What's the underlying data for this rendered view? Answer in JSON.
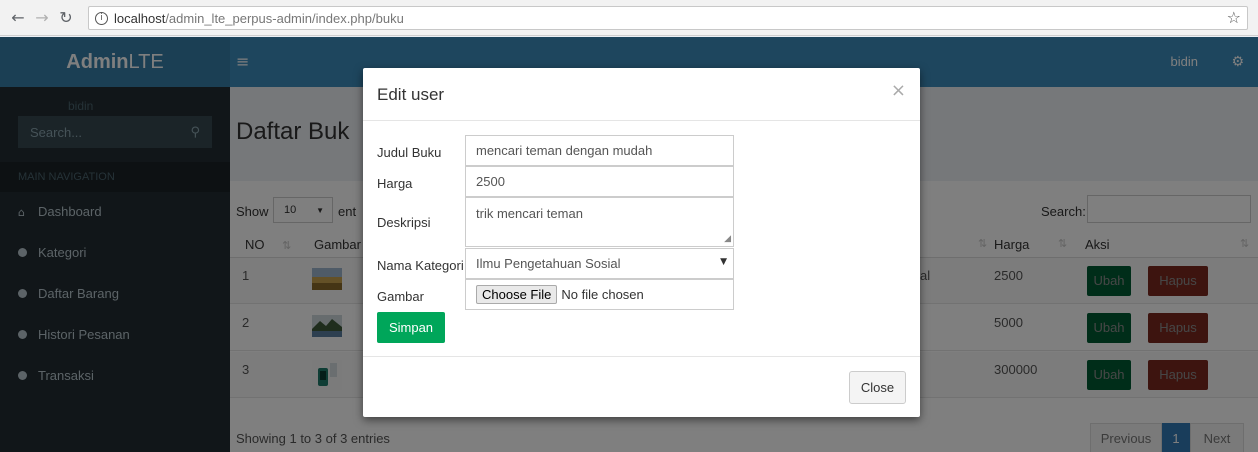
{
  "browser": {
    "back_icon": "arrow-left-icon",
    "forward_icon": "arrow-right-icon",
    "reload_icon": "reload-icon",
    "url_prefix": "localhost",
    "url_path": "/admin_lte_perpus-admin/index.php/buku"
  },
  "header": {
    "logo_bold": "Admin",
    "logo_rest": "LTE",
    "user": "bidin"
  },
  "sidebar": {
    "user": "bidin",
    "search_placeholder": "Search...",
    "nav_header": "MAIN NAVIGATION",
    "items": [
      {
        "label": "Dashboard",
        "icon": "home-icon"
      },
      {
        "label": "Kategori",
        "icon": "circle-icon"
      },
      {
        "label": "Daftar Barang",
        "icon": "circle-icon"
      },
      {
        "label": "Histori Pesanan",
        "icon": "circle-icon"
      },
      {
        "label": "Transaksi",
        "icon": "circle-icon"
      }
    ]
  },
  "content": {
    "title": "Daftar Buk",
    "show_label": "Show",
    "entries_length": "10",
    "entries_label": "ent",
    "search_label": "Search:",
    "columns": {
      "no": "NO",
      "gambar": "Gambar",
      "harga": "Harga",
      "aksi": "Aksi"
    },
    "rows": [
      {
        "no": "1",
        "tail": "al",
        "harga": "2500"
      },
      {
        "no": "2",
        "tail": "",
        "harga": "5000"
      },
      {
        "no": "3",
        "tail": "",
        "harga": "300000"
      }
    ],
    "btn_ubah": "Ubah",
    "btn_hapus": "Hapus",
    "footer_info": "Showing 1 to 3 of 3 entries",
    "pager": {
      "previous": "Previous",
      "current": "1",
      "next": "Next"
    }
  },
  "modal": {
    "title": "Edit user",
    "close_x": "×",
    "fields": {
      "judul_label": "Judul Buku",
      "judul_value": "mencari teman dengan mudah",
      "harga_label": "Harga",
      "harga_value": "2500",
      "deskripsi_label": "Deskripsi",
      "deskripsi_value": "trik mencari teman",
      "kategori_label": "Nama Kategori",
      "kategori_value": "Ilmu Pengetahuan Sosial",
      "gambar_label": "Gambar",
      "file_button": "Choose File",
      "file_status": "No file chosen"
    },
    "simpan": "Simpan",
    "close_button": "Close"
  },
  "colors": {
    "header": "#3c8dbc",
    "sidebar": "#222d32",
    "success": "#00a65a",
    "danger": "#dd4b39",
    "primary": "#337ab7"
  }
}
